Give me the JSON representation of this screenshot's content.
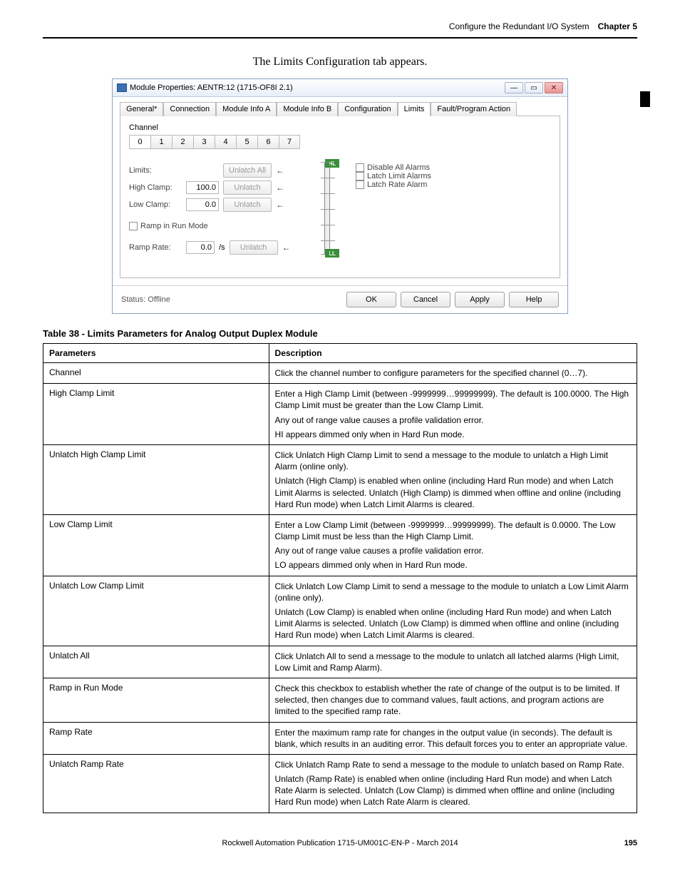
{
  "header": {
    "section": "Configure the Redundant I/O System",
    "chapter": "Chapter 5"
  },
  "caption": "The Limits Configuration tab appears.",
  "sideMark": true,
  "dialog": {
    "title": "Module Properties: AENTR:12 (1715-OF8I 2.1)",
    "winButtons": {
      "min": "—",
      "max": "▭",
      "close": "✕"
    },
    "tabs": [
      "General*",
      "Connection",
      "Module Info A",
      "Module Info B",
      "Configuration",
      "Limits",
      "Fault/Program Action"
    ],
    "activeTab": 5,
    "channelLabel": "Channel",
    "channels": [
      "0",
      "1",
      "2",
      "3",
      "4",
      "5",
      "6",
      "7"
    ],
    "selectedChannel": 0,
    "limitsLbl": "Limits:",
    "highClampLbl": "High Clamp:",
    "highClampVal": "100.0",
    "lowClampLbl": "Low Clamp:",
    "lowClampVal": "0.0",
    "rampChk": "Ramp in Run Mode",
    "rampRateLbl": "Ramp Rate:",
    "rampRateVal": "0.0",
    "rampRateUnit": "/s",
    "unlatchAll": "Unlatch All",
    "unlatch": "Unlatch",
    "markerHi": "HL",
    "markerLo": "LL",
    "disableAll": "Disable All Alarms",
    "latchLimit": "Latch Limit Alarms",
    "latchRate": "Latch Rate Alarm",
    "status": "Status: Offline",
    "ok": "OK",
    "cancel": "Cancel",
    "apply": "Apply",
    "help": "Help"
  },
  "tableTitle": "Table 38 - Limits Parameters for Analog Output Duplex Module",
  "th": {
    "param": "Parameters",
    "desc": "Description"
  },
  "rows": [
    {
      "p": "Channel",
      "d": [
        "Click the channel number to configure parameters for the specified channel (0…7)."
      ]
    },
    {
      "p": "High Clamp Limit",
      "d": [
        "Enter a High Clamp Limit (between -9999999…99999999). The default is 100.0000. The High Clamp Limit must be greater than the Low Clamp Limit.",
        "Any out of range value causes a profile validation error.",
        "HI appears dimmed only when in Hard Run mode."
      ]
    },
    {
      "p": "Unlatch High Clamp Limit",
      "d": [
        "Click Unlatch High Clamp Limit to send a message to the module to unlatch a High Limit Alarm (online only).",
        "Unlatch (High Clamp) is enabled when online (including Hard Run mode) and when Latch Limit Alarms is selected. Unlatch (High Clamp) is dimmed when offline and online (including Hard Run mode) when Latch Limit Alarms is cleared."
      ]
    },
    {
      "p": "Low Clamp Limit",
      "d": [
        "Enter a Low Clamp Limit (between -9999999…99999999). The default is 0.0000. The Low Clamp Limit must be less than the High Clamp Limit.",
        "Any out of range value causes a profile validation error.",
        "LO appears dimmed only when in Hard Run mode."
      ]
    },
    {
      "p": "Unlatch Low Clamp Limit",
      "d": [
        "Click Unlatch Low Clamp Limit to send a message to the module to unlatch a Low Limit Alarm (online only).",
        "Unlatch (Low Clamp) is enabled when online (including Hard Run mode) and when Latch Limit Alarms is selected. Unlatch (Low Clamp) is dimmed when offline and online (including Hard Run mode) when Latch Limit Alarms is cleared."
      ]
    },
    {
      "p": "Unlatch All",
      "d": [
        "Click Unlatch All to send a message to the module to unlatch all latched alarms (High Limit, Low Limit and Ramp Alarm)."
      ]
    },
    {
      "p": "Ramp in Run Mode",
      "d": [
        "Check this checkbox to establish whether the rate of change of the output is to be limited. If selected, then changes due to command values, fault actions, and program actions are limited to the specified ramp rate."
      ]
    },
    {
      "p": "Ramp Rate",
      "d": [
        "Enter the maximum ramp rate for changes in the output value (in seconds). The default is blank, which results in an auditing error. This default forces you to enter an appropriate value."
      ]
    },
    {
      "p": "Unlatch Ramp Rate",
      "d": [
        "Click Unlatch Ramp Rate to send a message to the module to unlatch based on Ramp Rate.",
        "Unlatch (Ramp Rate) is enabled when online (including Hard Run mode) and when Latch Rate Alarm is selected. Unlatch (Low Clamp) is dimmed when offline and online (including Hard Run mode) when Latch Rate Alarm is cleared."
      ]
    }
  ],
  "footer": {
    "pub": "Rockwell Automation Publication 1715-UM001C-EN-P - March 2014",
    "page": "195"
  }
}
